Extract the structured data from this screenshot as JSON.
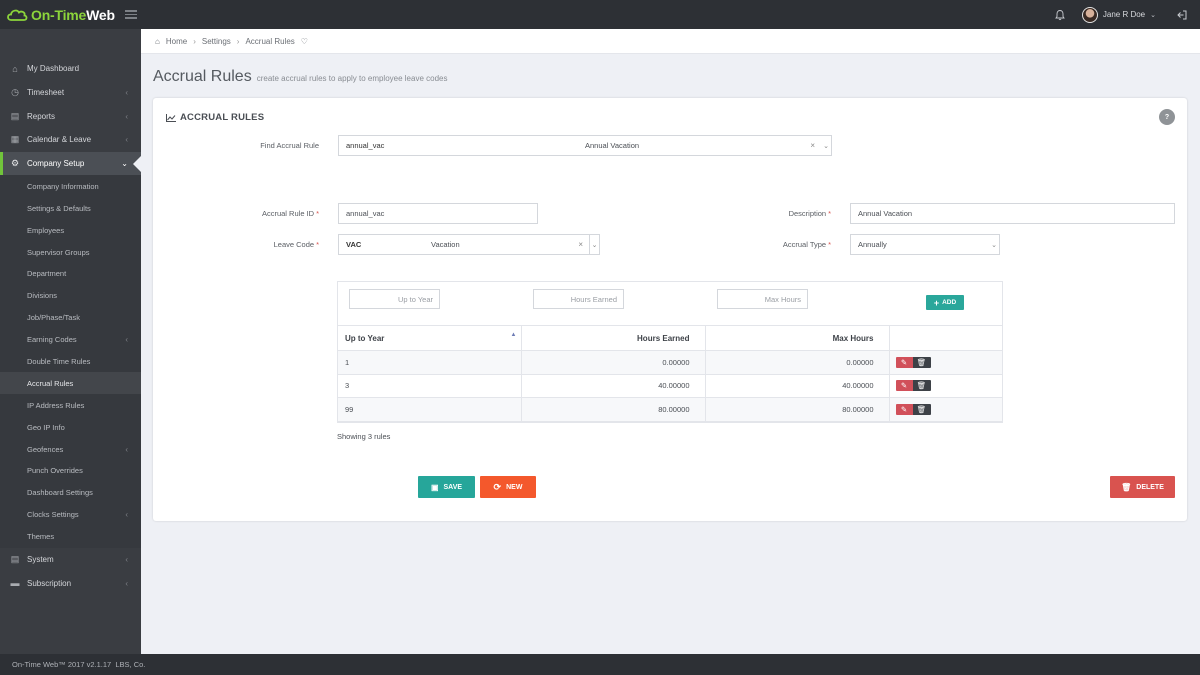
{
  "app": {
    "brand_part1": "On-Time",
    "brand_part2": "Web"
  },
  "topbar": {
    "user_name": "Jane R Doe"
  },
  "sidebar": {
    "items": [
      {
        "label": "My Dashboard",
        "icon": "home-icon"
      },
      {
        "label": "Timesheet",
        "icon": "clock-icon"
      },
      {
        "label": "Reports",
        "icon": "chart-icon"
      },
      {
        "label": "Calendar & Leave",
        "icon": "calendar-icon"
      },
      {
        "label": "Company Setup",
        "icon": "cogs-icon"
      }
    ],
    "sub_items": [
      "Company Information",
      "Settings & Defaults",
      "Employees",
      "Supervisor Groups",
      "Department",
      "Divisions",
      "Job/Phase/Task",
      "Earning Codes",
      "Double Time Rules",
      "Accrual Rules",
      "IP Address Rules",
      "Geo IP Info",
      "Geofences",
      "Punch Overrides",
      "Dashboard Settings",
      "Clocks Settings",
      "Themes"
    ],
    "bottom_items": [
      {
        "label": "System",
        "icon": "system-icon"
      },
      {
        "label": "Subscription",
        "icon": "card-icon"
      }
    ]
  },
  "breadcrumb": {
    "home": "Home",
    "settings": "Settings",
    "current": "Accrual Rules"
  },
  "page": {
    "title": "Accrual Rules",
    "subtitle": "create accrual rules to apply to employee leave codes"
  },
  "card": {
    "title": "ACCRUAL RULES",
    "help": "?",
    "find_label": "Find Accrual Rule",
    "find_code": "annual_vac",
    "find_desc": "Annual Vacation",
    "id_label": "Accrual Rule ID",
    "id_value": "annual_vac",
    "desc_label": "Description",
    "desc_value": "Annual Vacation",
    "leave_label": "Leave Code",
    "leave_code": "VAC",
    "leave_desc": "Vacation",
    "type_label": "Accrual Type",
    "type_value": "Annually",
    "req_mark": "*"
  },
  "table": {
    "ph_up_to_year": "Up to Year",
    "ph_hours_earned": "Hours Earned",
    "ph_max_hours": "Max Hours",
    "add_label": "ADD",
    "headers": [
      "Up to Year",
      "Hours Earned",
      "Max Hours"
    ],
    "rows": [
      [
        "1",
        "0.00000",
        "0.00000"
      ],
      [
        "3",
        "40.00000",
        "40.00000"
      ],
      [
        "99",
        "80.00000",
        "80.00000"
      ]
    ],
    "showing": "Showing 3 rules"
  },
  "buttons": {
    "save": "SAVE",
    "new": "NEW",
    "delete": "DELETE"
  },
  "footer": {
    "text": "On-Time Web™ 2017 v2.1.17  LBS, Co."
  }
}
